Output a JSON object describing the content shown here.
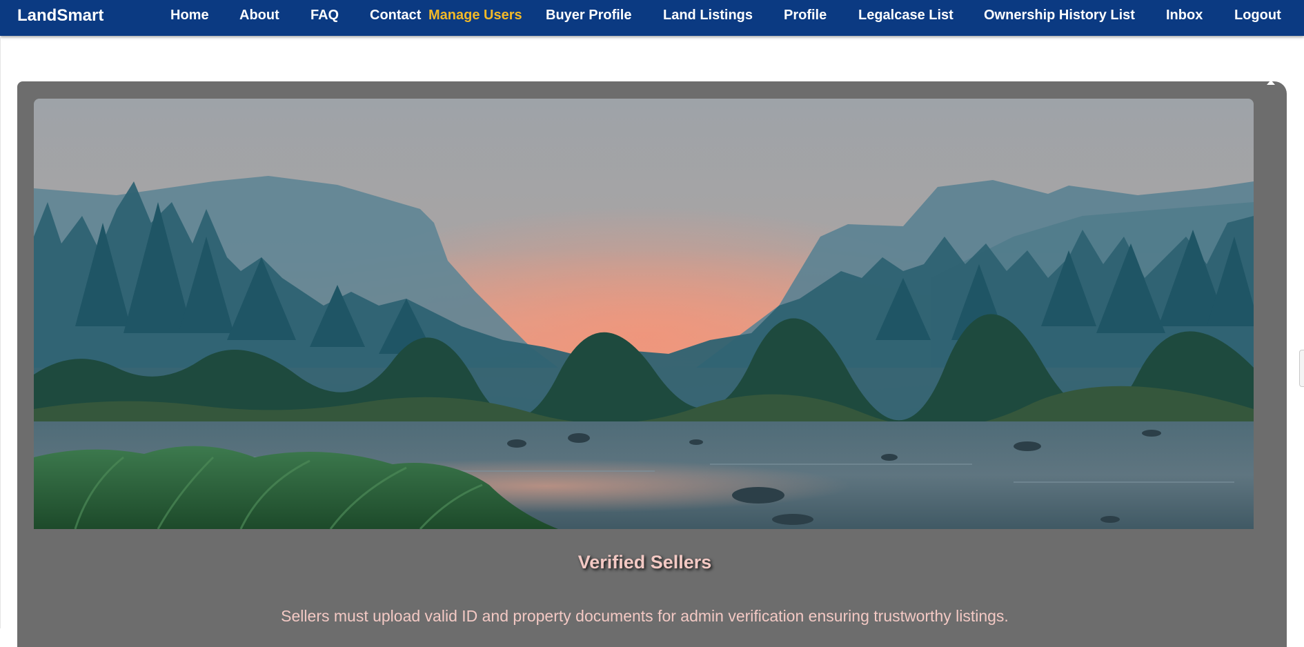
{
  "navbar": {
    "brand": "LandSmart",
    "items": [
      {
        "label": "Home"
      },
      {
        "label": "About"
      },
      {
        "label": "FAQ"
      },
      {
        "label": "Contact"
      },
      {
        "label": "Manage Users",
        "active": true
      },
      {
        "label": "Buyer Profile"
      },
      {
        "label": "Land Listings"
      },
      {
        "label": "Profile"
      },
      {
        "label": "Legalcase List"
      },
      {
        "label": "Ownership History List"
      },
      {
        "label": "Inbox"
      },
      {
        "label": "Logout"
      }
    ],
    "colors": {
      "background": "#0b3a82",
      "text": "#ffffff",
      "active": "#f2b928"
    }
  },
  "feature_card": {
    "title": "Verified Sellers",
    "description": "Sellers must upload valid ID and property documents for admin verification ensuring trustworthy listings.",
    "image": "mountain-valley-river-sunrise-photo",
    "colors": {
      "card_background": "#6d6d6d",
      "text": "#f3c9c4"
    }
  }
}
